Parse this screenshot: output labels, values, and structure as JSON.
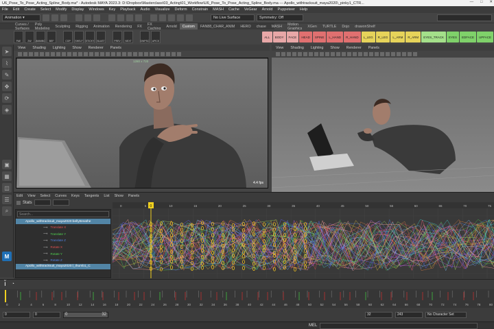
{
  "titlebar": {
    "text": "U6_Pose_To_Pose_Acting_Spline_Body.ma* - Autodesk MAYA 2023.3: D:\\Dropbox\\Masterclass\\03_Acting\\01_Workflow\\U6_Pose_To_Pose_Acting_Spline_Body.ma  ---  Apollo_withtracksuit_maya2020\\_pinky1_CTR...",
    "minimize": "—",
    "maximize": "□",
    "close": "✕"
  },
  "menubar": [
    "File",
    "Edit",
    "Create",
    "Select",
    "Modify",
    "Display",
    "Windows",
    "Key",
    "Playback",
    "Audio",
    "Visualize",
    "Deform",
    "Constrain",
    "MASH",
    "Cache",
    "VeGear",
    "Arnold",
    "Puppeteer",
    "Help"
  ],
  "statusline": {
    "workspace": "Animation",
    "live_surface": "No Live Surface",
    "symmetry": "Symmetry: Off"
  },
  "shelf_tabs": [
    "Curves / Surfaces",
    "Poly Modeling",
    "Sculpting",
    "Rigging",
    "Animation",
    "Rendering",
    "FX",
    "FX Caching",
    "Arnold",
    "Custom",
    "FAN88_CHAR_ANIM",
    "HERO",
    "chase",
    "MASH",
    "Motion Graphics",
    "XGen",
    "TURTLE",
    "Dojo",
    "drawonShelf"
  ],
  "active_shelf_tab": "Custom",
  "shelf_icons": [
    "PAE",
    "2W",
    "ANIMBC",
    "BEF",
    "",
    "CGP",
    "SHELF",
    "STICKY",
    "BLAST",
    "",
    "PREV",
    "NEXT",
    "",
    "DWPSC",
    "APICK"
  ],
  "selection_buttons": [
    {
      "label": "ALL",
      "color": "#e8a7a7"
    },
    {
      "label": "BODY",
      "color": "#e8a7a7"
    },
    {
      "label": "FACE",
      "color": "#e8a7a7"
    },
    {
      "label": "HEAD",
      "color": "#e07070"
    },
    {
      "label": "SPINE",
      "color": "#e07070"
    },
    {
      "label": "L_HAND",
      "color": "#e07070"
    },
    {
      "label": "R_HAND",
      "color": "#e07070"
    },
    {
      "label": "L_LEG",
      "color": "#e6d35a"
    },
    {
      "label": "R_LEG",
      "color": "#e6d35a"
    },
    {
      "label": "L_ARM",
      "color": "#e6d35a"
    },
    {
      "label": "R_ARM",
      "color": "#e6d35a"
    },
    {
      "label": "EYES_TRACK",
      "color": "#a4e08a"
    },
    {
      "label": "EYES",
      "color": "#7fd16a"
    },
    {
      "label": "EDFACE",
      "color": "#7fd16a"
    },
    {
      "label": "UPFACE",
      "color": "#7fd16a"
    }
  ],
  "viewport_menu": [
    "View",
    "Shading",
    "Lighting",
    "Show",
    "Renderer",
    "Panels"
  ],
  "viewport1": {
    "resolution": "1280 x 720",
    "fps": "4.4 fps"
  },
  "graph_editor": {
    "menu": [
      "Edit",
      "View",
      "Select",
      "Curves",
      "Keys",
      "Tangents",
      "List",
      "Show",
      "Panels"
    ],
    "stats_label": "Stats",
    "search_placeholder": "Search...",
    "outliner": [
      {
        "label": "Apollo_withtracksuit_maya2020:bellyBreathe",
        "selected": true
      },
      {
        "label": "Translate X",
        "color": "#e05050"
      },
      {
        "label": "Translate Y",
        "color": "#50d050"
      },
      {
        "label": "Translate Z",
        "color": "#5080e0"
      },
      {
        "label": "Rotate X",
        "color": "#e05050"
      },
      {
        "label": "Rotate Y",
        "color": "#50d050"
      },
      {
        "label": "Rotate Z",
        "color": "#5080e0"
      },
      {
        "label": "Apollo_withtracksuit_maya2020:l_thumb1_C",
        "selected": true
      }
    ],
    "ruler": [
      "0",
      "5",
      "10",
      "15",
      "20",
      "25",
      "30",
      "35",
      "40",
      "45",
      "50",
      "55",
      "60",
      "65",
      "70",
      "75"
    ],
    "current_frame_marker": "0"
  },
  "timeslider": {
    "ticks": [
      "0",
      "2",
      "4",
      "6",
      "8",
      "10",
      "12",
      "14",
      "16",
      "18",
      "20",
      "22",
      "24",
      "26",
      "28",
      "30",
      "32",
      "34",
      "36",
      "38",
      "40",
      "42",
      "44",
      "46",
      "48",
      "50",
      "52",
      "54",
      "56",
      "58",
      "60",
      "62",
      "64",
      "66",
      "68",
      "70",
      "72",
      "74",
      "76",
      "78",
      "80"
    ]
  },
  "range": {
    "start": "0",
    "anim_start": "0",
    "range_start": "0",
    "range_end": "32",
    "anim_end": "32",
    "end": "243",
    "character_set": "No Character Set",
    "current": "0"
  },
  "cmdline": {
    "lang": "MEL"
  }
}
